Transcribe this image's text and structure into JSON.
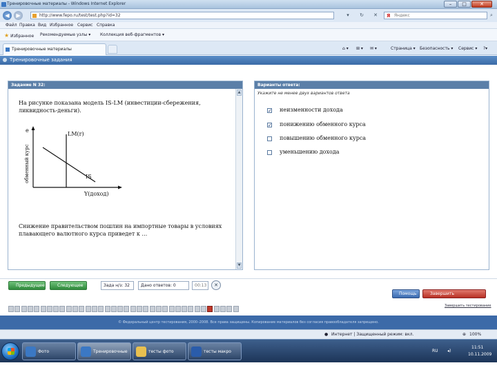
{
  "window": {
    "title": "Тренировочные материалы - Windows Internet Explorer",
    "minimize": "–",
    "maximize": "□",
    "close": "✕"
  },
  "addressbar": {
    "back": "◀",
    "forward": "▶",
    "url": "http://www.fepo.ru/test/test.php?id=32",
    "search_placeholder": "Яндекс",
    "search_logo": "Я",
    "refresh": "↻",
    "stop": "✕",
    "rss": "▾"
  },
  "menu": {
    "items": [
      "Файл",
      "Правка",
      "Вид",
      "Избранное",
      "Сервис",
      "Справка"
    ]
  },
  "favorites": {
    "label": "Избранное",
    "items": [
      "Рекомендуемые узлы ▾",
      "Коллекция веб-фрагментов ▾"
    ]
  },
  "tabs": {
    "active": "Тренировочные материалы"
  },
  "commandbar": {
    "items": [
      "Страница ▾",
      "Безопасность ▾",
      "Сервис ▾"
    ],
    "icons": [
      "⌂ ▾",
      "⊞ ▾",
      "✉ ▾"
    ],
    "help": "?▾"
  },
  "page": {
    "header": "Тренировочные задания"
  },
  "task": {
    "title": "Задание N 32:",
    "question": "На рисунке показана модель IS-LM (инвестиции-сбережения, ликвидность-деньги).",
    "question_cont": "Снижение правительством пошлин на импортные товары в условиях плавающего валютного курса  приведет к …"
  },
  "graph": {
    "y_label": "обменный курс",
    "y_letter": "e",
    "lm_label": "LM(r)",
    "is_label": "IS",
    "x_label": "Y(доход)"
  },
  "answers": {
    "title": "Варианты ответа:",
    "hint": "Укажите не менее двух вариантов ответа",
    "options": [
      {
        "label": "неизменности дохода",
        "checked": true
      },
      {
        "label": "понижению обменного курса",
        "checked": true
      },
      {
        "label": "повышению обменного курса",
        "checked": false
      },
      {
        "label": "уменьшению дохода",
        "checked": false
      }
    ]
  },
  "nav": {
    "prev": "Предыдущее",
    "next": "Следующее",
    "task_counter": "Зада н/з: 32",
    "answered": "Дано ответов: 0",
    "timer": "00:13",
    "help": "Помощь",
    "finish": "Завершить тестирование",
    "end_link": "Завершить тестирование"
  },
  "question_grid": {
    "count": 36,
    "current": 32,
    "first_number": 1
  },
  "footer": {
    "text": "© Федеральный центр тестирования, 2000–2008. Все права защищены. Копирование материалов без согласия правообладателя запрещено."
  },
  "statusbar": {
    "zone": "Интернет | Защищенный режим: вкл.",
    "zoom": "100%"
  },
  "taskbar": {
    "buttons": [
      "Фото тренировоч...",
      "Тренировочные ...",
      "тесты фото",
      "тесты макро [Ре..."
    ],
    "lang": "RU",
    "time": "11:51",
    "date": "10.11.2009"
  }
}
